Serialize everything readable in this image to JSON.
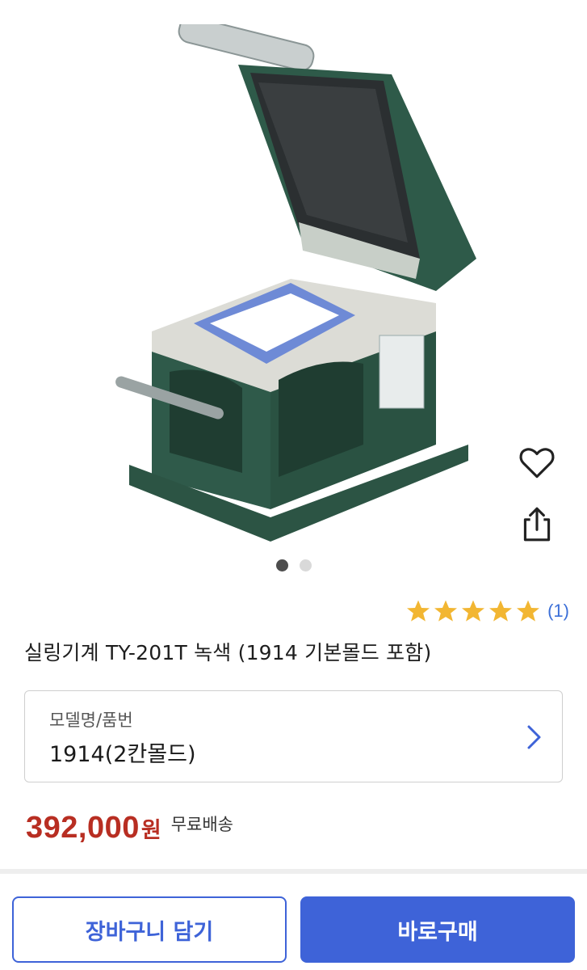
{
  "product": {
    "image_alt": "실링기계 TY-201T",
    "title": "실링기계 TY-201T 녹색 (1914 기본몰드 포함)",
    "rating": {
      "stars": 5,
      "count_text": "(1)"
    },
    "gallery": {
      "current": 1,
      "total": 2
    }
  },
  "actions": {
    "like_icon": "heart-icon",
    "share_icon": "share-icon"
  },
  "option": {
    "label": "모델명/품번",
    "value": "1914(2칸몰드)",
    "icon": "chevron-right-icon"
  },
  "price": {
    "amount": "392,000",
    "unit": "원",
    "shipping": "무료배송"
  },
  "buttons": {
    "cart": "장바구니 담기",
    "buy": "바로구매"
  },
  "colors": {
    "accent": "#3e63d8",
    "price": "#b82e22",
    "star": "#f2b632",
    "machine_green": "#2f5a4a"
  }
}
